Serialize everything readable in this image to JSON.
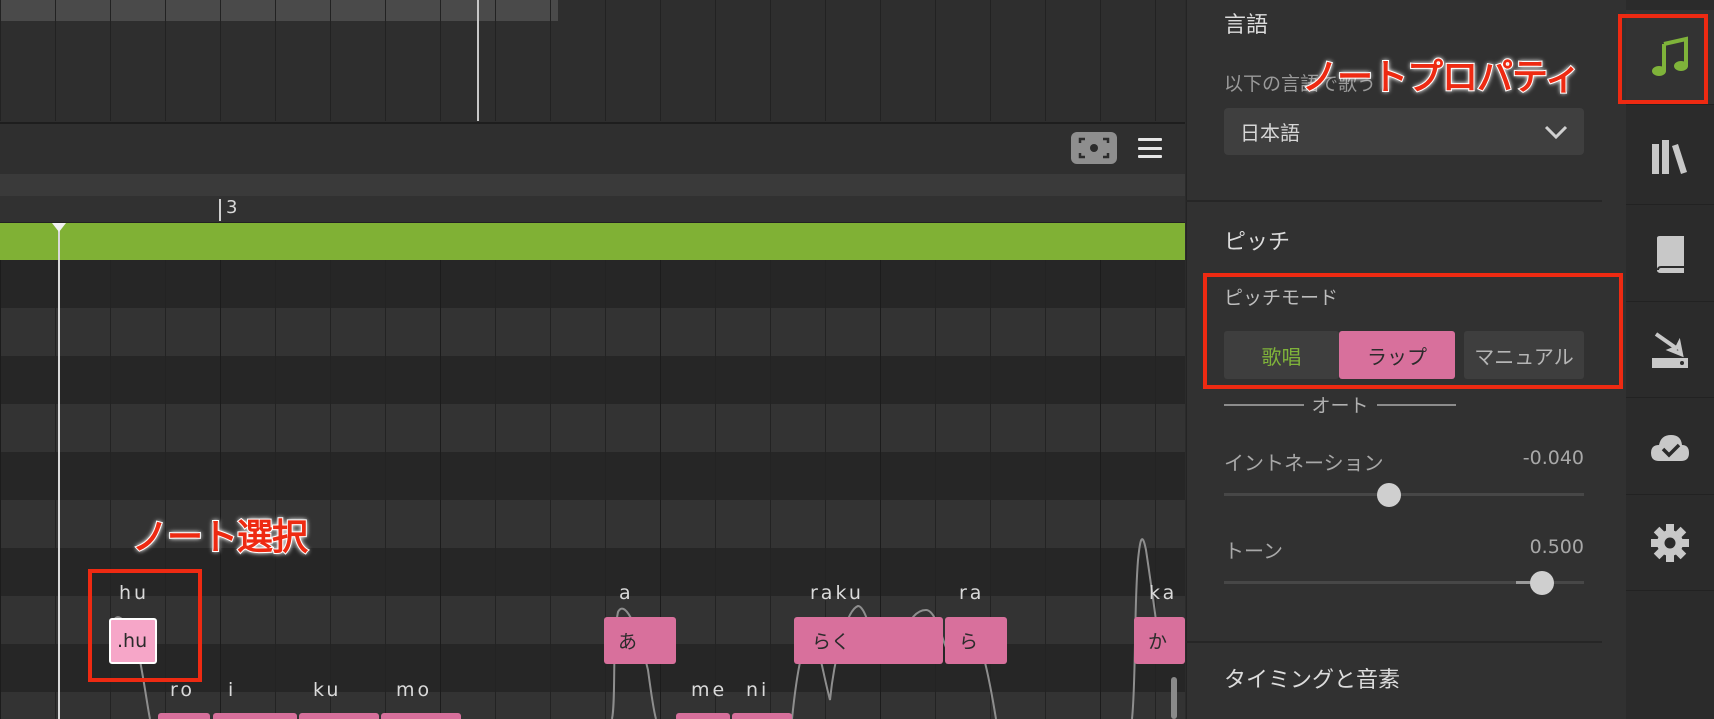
{
  "editor": {
    "ruler": {
      "measure_label": "3"
    },
    "toolbar": {
      "focus_icon": "focus-camera-icon",
      "menu_icon": "hamburger-menu-icon"
    },
    "notes": [
      {
        "lyric": "hu",
        "text": ".hu",
        "selected": true
      },
      {
        "lyric": "a",
        "text": "あ",
        "selected": false
      },
      {
        "lyric": "raku",
        "text": "らく",
        "selected": false
      },
      {
        "lyric": "ra",
        "text": "ら",
        "selected": false
      },
      {
        "lyric": "ka",
        "text": "か",
        "selected": false
      }
    ],
    "lower_lyrics": [
      "ro",
      "i",
      "ku",
      "mo",
      "me",
      "ni"
    ],
    "colors": {
      "tempo_bar": "#80b135",
      "note": "#d8709c",
      "note_selected": "#f6a6c8"
    }
  },
  "annotations": {
    "note_select": "ノート選択",
    "note_property": "ノートプロパティ",
    "color": "#ee2a12"
  },
  "panel": {
    "language": {
      "title": "言語",
      "description": "以下の言語で歌う",
      "selected": "日本語"
    },
    "pitch": {
      "title": "ピッチ",
      "mode_label": "ピッチモード",
      "modes": [
        "歌唱",
        "ラップ",
        "マニュアル"
      ],
      "active_mode": "ラップ",
      "auto_label": "オート",
      "intonation": {
        "label": "イントネーション",
        "value": "-0.040",
        "level": 0.46
      },
      "tone": {
        "label": "トーン",
        "value": "0.500",
        "level": 0.89
      }
    },
    "timing": {
      "title": "タイミングと音素"
    }
  },
  "iconbar": {
    "items": [
      "music-note-icon",
      "library-icon",
      "book-icon",
      "export-icon",
      "cloud-check-icon",
      "gear-icon"
    ],
    "active": "music-note-icon",
    "accent": "#7fb33a"
  }
}
